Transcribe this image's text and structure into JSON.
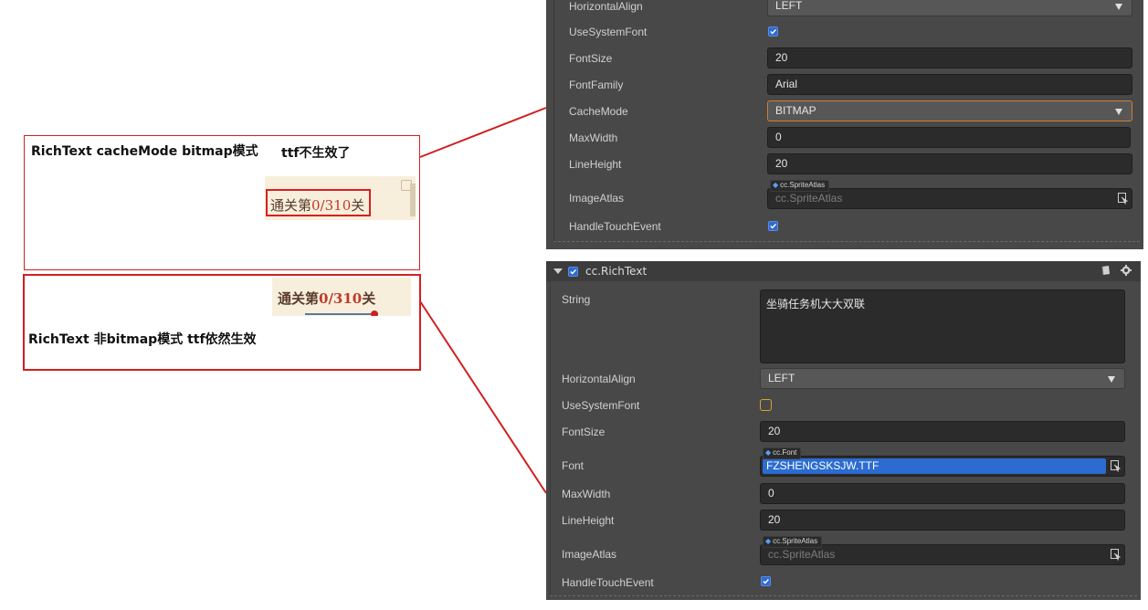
{
  "annotations": {
    "box1_title": "RichText  cacheMode bitmap模式",
    "box1_note": "ttf不生效了",
    "box2_title": "RichText 非bitmap模式  ttf依然生效",
    "game_text_prefix": "通关第",
    "game_text_number": "0/310",
    "game_text_suffix": "关"
  },
  "top_panel": {
    "props": [
      {
        "label": "HorizontalAlign",
        "value": "LEFT",
        "type": "select"
      },
      {
        "label": "UseSystemFont",
        "value": "checked",
        "type": "checkbox"
      },
      {
        "label": "FontSize",
        "value": "20",
        "type": "number"
      },
      {
        "label": "FontFamily",
        "value": "Arial",
        "type": "text"
      },
      {
        "label": "CacheMode",
        "value": "BITMAP",
        "type": "select"
      },
      {
        "label": "MaxWidth",
        "value": "0",
        "type": "number"
      },
      {
        "label": "LineHeight",
        "value": "20",
        "type": "number"
      },
      {
        "label": "ImageAtlas",
        "value": "cc.SpriteAtlas",
        "tag": "cc.SpriteAtlas",
        "type": "asset"
      },
      {
        "label": "HandleTouchEvent",
        "value": "checked",
        "type": "checkbox"
      }
    ]
  },
  "bottom_panel": {
    "component_title": "cc.RichText",
    "props": [
      {
        "label": "String",
        "value": "坐骑任务机大大双联",
        "type": "textarea"
      },
      {
        "label": "HorizontalAlign",
        "value": "LEFT",
        "type": "select"
      },
      {
        "label": "UseSystemFont",
        "value": "unchecked",
        "type": "checkbox"
      },
      {
        "label": "FontSize",
        "value": "20",
        "type": "number"
      },
      {
        "label": "Font",
        "value": "FZSHENGSKSJW.TTF",
        "tag": "cc.Font",
        "type": "asset"
      },
      {
        "label": "MaxWidth",
        "value": "0",
        "type": "number"
      },
      {
        "label": "LineHeight",
        "value": "20",
        "type": "number"
      },
      {
        "label": "ImageAtlas",
        "value": "cc.SpriteAtlas",
        "tag": "cc.SpriteAtlas",
        "type": "asset"
      },
      {
        "label": "HandleTouchEvent",
        "value": "checked",
        "type": "checkbox"
      }
    ]
  },
  "colors": {
    "annotation_red": "#d02020",
    "panel_bg": "#484848",
    "field_bg": "#2b2b2b",
    "accent_blue": "#2c6cd0",
    "focus_orange": "#d08030"
  },
  "icons": [
    "check-icon",
    "dropdown-caret-icon",
    "asset-picker-icon",
    "help-book-icon",
    "gear-icon",
    "collapse-arrow-icon"
  ]
}
